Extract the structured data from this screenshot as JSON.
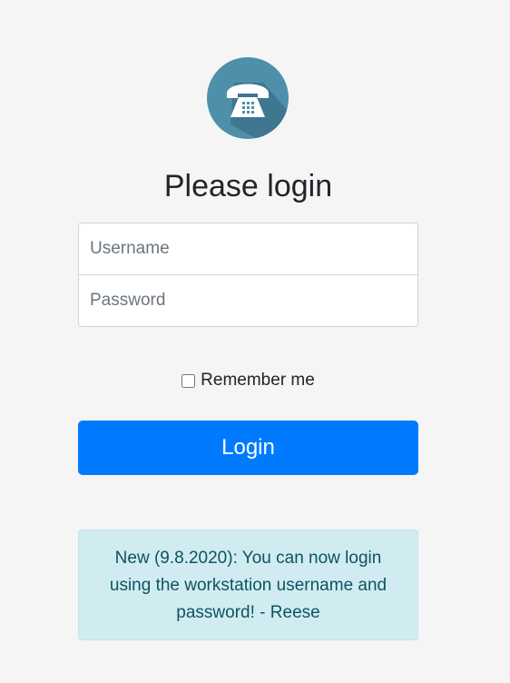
{
  "logo": {
    "icon": "telephone-icon",
    "background_color": "#4e8faa"
  },
  "login": {
    "heading": "Please login",
    "username_placeholder": "Username",
    "password_placeholder": "Password",
    "remember_label": "Remember me",
    "remember_checked": false,
    "button_label": "Login",
    "button_color": "#007bff"
  },
  "notice": {
    "text": "New (9.8.2020): You can now login using the workstation username and password! - Reese",
    "background_color": "#d1ecf1"
  }
}
